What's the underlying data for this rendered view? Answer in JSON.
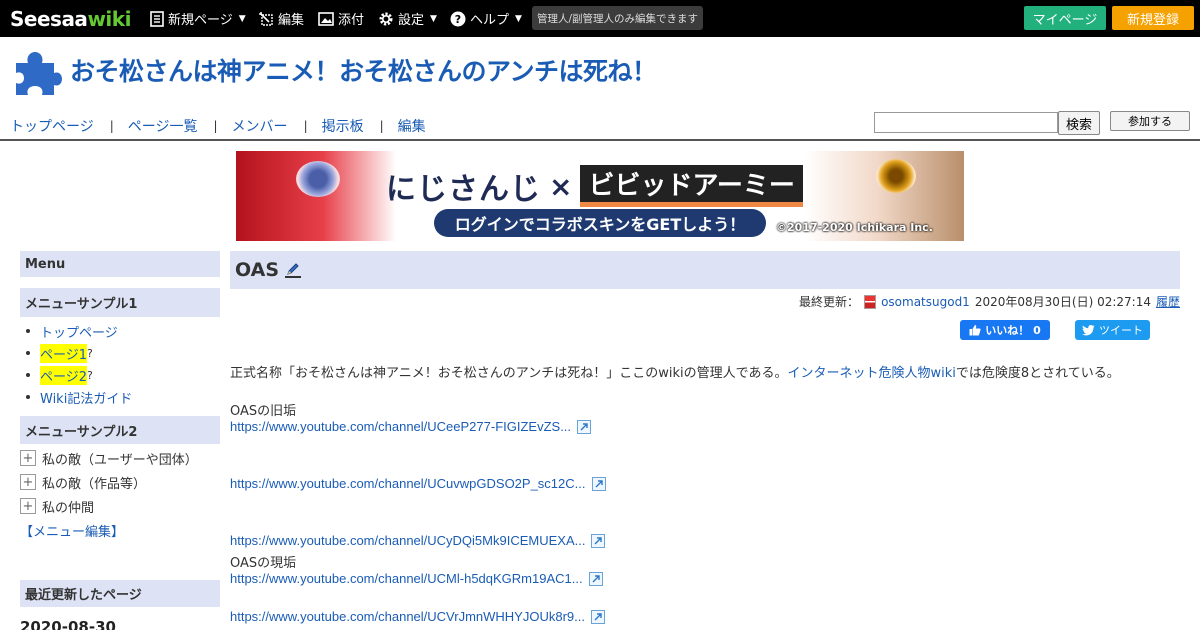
{
  "topbar": {
    "logo_main": "Seesaa",
    "logo_wiki": "wiki",
    "new_page": "新規ページ",
    "edit": "編集",
    "attach": "添付",
    "settings": "設定",
    "help": "ヘルプ",
    "admin_note": "管理人/副管理人のみ編集できます",
    "mypage": "マイページ",
    "register": "新規登録"
  },
  "site": {
    "title": "おそ松さんは神アニメ！おそ松さんのアンチは死ね！"
  },
  "nav": {
    "items": [
      "トップページ",
      "ページ一覧",
      "メンバー",
      "掲示板",
      "編集"
    ],
    "search_button": "検索",
    "join_button": "参加する"
  },
  "banner": {
    "brand_left": "にじさんじ",
    "cross": "×",
    "brand_right": "ビビッドアーミー",
    "cta": "ログインでコラボスキンをGETしよう！",
    "copyright": "©2017-2020 Ichikara Inc."
  },
  "sidebar": {
    "menu_title": "Menu",
    "sample1_title": "メニューサンプル1",
    "sample1_items": {
      "top": "トップページ",
      "page1": "ページ1",
      "page2": "ページ2",
      "guide": "Wiki記法ガイド",
      "q": "?"
    },
    "sample2_title": "メニューサンプル2",
    "tree": [
      "私の敵（ユーザーや団体）",
      "私の敵（作品等）",
      "私の仲間"
    ],
    "menu_edit": "【メニュー編集】",
    "recent_title": "最近更新したページ",
    "recent_date": "2020-08-30"
  },
  "page": {
    "title": "OAS",
    "last_updated_label": "最終更新：",
    "author": "osomatsugod1",
    "updated_at": "2020年08月30日(日) 02:27:14",
    "history": "履歴",
    "like_button": "いいね！ 0",
    "tweet_button": "ツイート",
    "intro_before": "正式名称「おそ松さんは神アニメ！おそ松さんのアンチは死ね！」ここのwikiの管理人である。",
    "intro_link": "インターネット危険人物wiki",
    "intro_after": "では危険度8とされている。",
    "old_heading": "OASの旧垢",
    "current_heading": "OASの現垢",
    "links": [
      "https://www.youtube.com/channel/UCeeP277-FIGIZEvZS...",
      "https://www.youtube.com/channel/UCuvwpGDSO2P_sc12C...",
      "https://www.youtube.com/channel/UCyDQi5Mk9ICEMUEXA...",
      "https://www.youtube.com/channel/UCMl-h5dqKGRm19AC1...",
      "https://www.youtube.com/channel/UCVrJmnWHHYJOUk8r9..."
    ]
  },
  "colors": {
    "topbar_bg": "#000000",
    "mypage_btn": "#22b07d",
    "register_btn": "#f5a100",
    "link": "#1a5cb5",
    "sidebar_header_bg": "#dde3f5",
    "highlight": "#ffff00"
  }
}
